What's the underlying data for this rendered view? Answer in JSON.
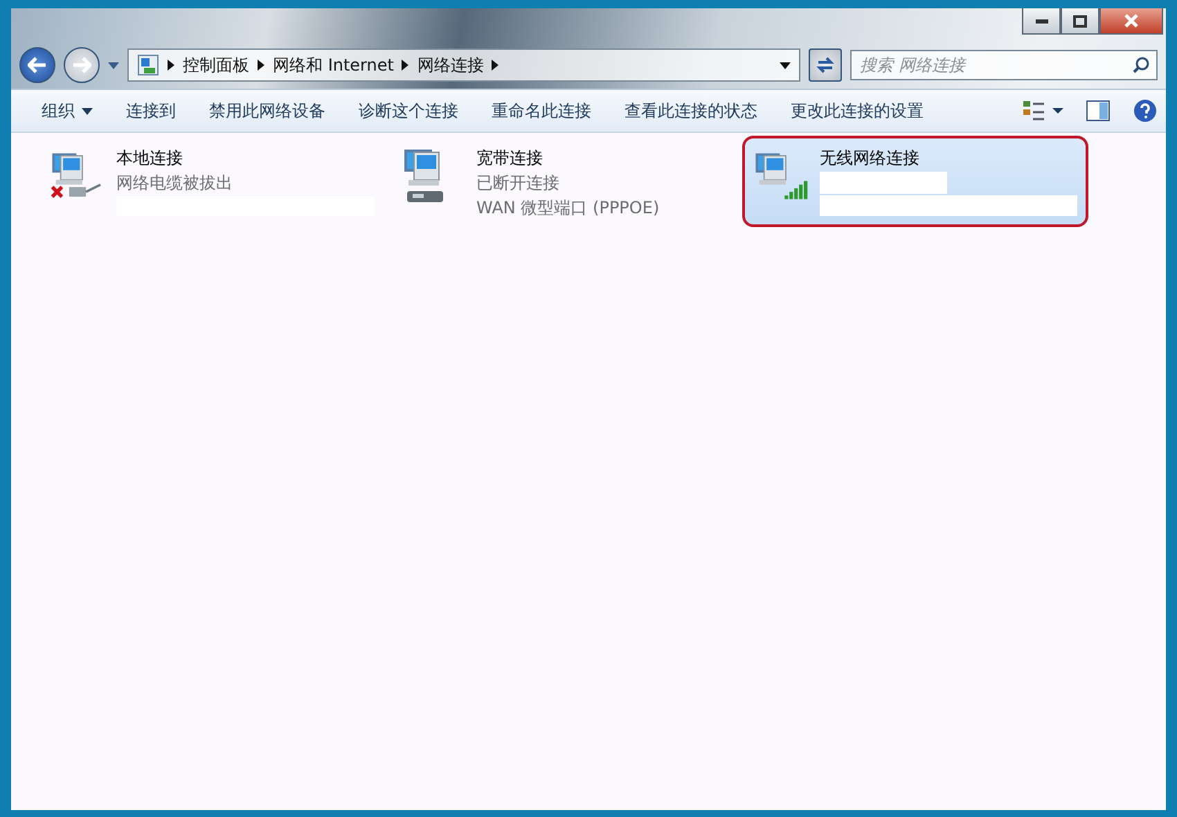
{
  "address_bar": {
    "crumbs": [
      "控制面板",
      "网络和 Internet",
      "网络连接"
    ]
  },
  "search": {
    "placeholder": "搜索 网络连接"
  },
  "toolbar": {
    "items": [
      {
        "label": "组织",
        "dropdown": true
      },
      {
        "label": "连接到",
        "dropdown": false
      },
      {
        "label": "禁用此网络设备",
        "dropdown": false
      },
      {
        "label": "诊断这个连接",
        "dropdown": false
      },
      {
        "label": "重命名此连接",
        "dropdown": false
      },
      {
        "label": "查看此连接的状态",
        "dropdown": false
      },
      {
        "label": "更改此连接的设置",
        "dropdown": false
      }
    ]
  },
  "connections": [
    {
      "kind": "cable",
      "name": "本地连接",
      "status": "网络电缆被拔出",
      "selected": false,
      "highlighted": false
    },
    {
      "kind": "modem",
      "name": "宽带连接",
      "status": "已断开连接",
      "device": "WAN 微型端口 (PPPOE)",
      "selected": false,
      "highlighted": false
    },
    {
      "kind": "wireless",
      "name": "无线网络连接",
      "selected": true,
      "highlighted": true
    }
  ]
}
